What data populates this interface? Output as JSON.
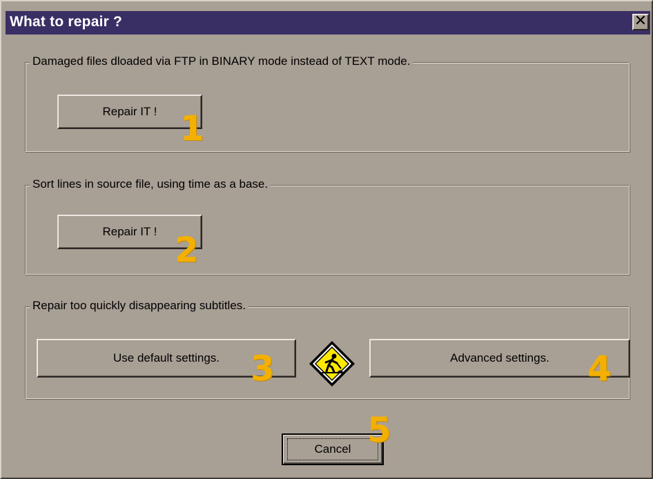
{
  "window": {
    "title": "What to repair ?",
    "close_symbol": "✕"
  },
  "groups": [
    {
      "label": "Damaged files dloaded via FTP in BINARY mode instead of TEXT mode.",
      "button_label": "Repair IT !",
      "number": "1"
    },
    {
      "label": "Sort lines in source file, using time as a base.",
      "button_label": "Repair IT !",
      "number": "2"
    },
    {
      "label": "Repair too quickly disappearing subtitles.",
      "default_button_label": "Use default settings.",
      "default_number": "3",
      "advanced_button_label": "Advanced settings.",
      "advanced_number": "4",
      "sign_icon": "roadwork-warning-icon"
    }
  ],
  "footer": {
    "cancel_label": "Cancel",
    "cancel_number": "5"
  },
  "colors": {
    "dialog_background": "#a89f95",
    "titlebar": "#3a2f64",
    "annotation_numbers": "#f4b000",
    "sign_yellow": "#ffe800"
  }
}
